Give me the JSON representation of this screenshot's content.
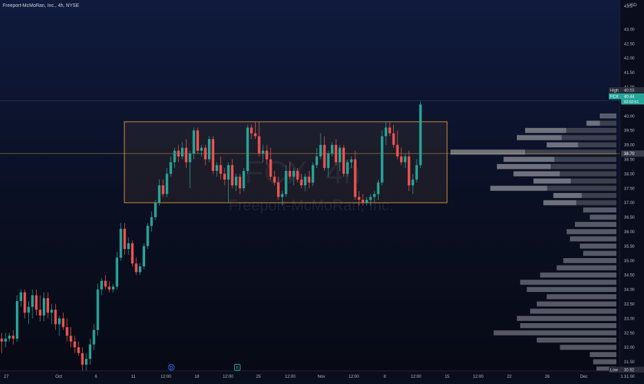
{
  "header": {
    "symbol_title": "Freeport-McMoRan, Inc., 4h, NYSE",
    "currency": "USD"
  },
  "watermark": {
    "ticker": "FCX, 4h",
    "name": "Freeport-McMoRan, Inc."
  },
  "colors": {
    "up": "#26a69a",
    "down": "#ef5350",
    "range_box": "#e8a33d",
    "volume_profile": "#787b86",
    "volume_profile_value_area": "#434651",
    "last_price_bg": "#26a69a",
    "high_bg": "#2a2e39",
    "low_bg": "#2a2e39"
  },
  "price_labels": {
    "high_label": "High",
    "high_value": "40.53",
    "ticker_label": "FCX",
    "last_value": "40.44",
    "countdown": "02:02:51",
    "level_value": "38.70",
    "low_label": "Low",
    "low_value": "30.92"
  },
  "event_markers": [
    {
      "label": "D",
      "x_label": "11"
    },
    {
      "label": "E",
      "x_label": "18"
    }
  ],
  "chart_data": {
    "type": "candlestick",
    "title": "Freeport-McMoRan, Inc., 4h, NYSE",
    "xlabel": "",
    "ylabel": "",
    "ylim": [
      30.9,
      43.6
    ],
    "y_ticks": [
      "43.00",
      "42.50",
      "42.00",
      "41.50",
      "41.00",
      "40.50",
      "40.00",
      "39.50",
      "39.00",
      "38.50",
      "38.00",
      "37.50",
      "37.00",
      "36.50",
      "36.00",
      "35.50",
      "35.00",
      "34.50",
      "34.00",
      "33.50",
      "33.00",
      "32.50",
      "32.00",
      "31.50",
      "31.00"
    ],
    "top_tick_partial": "43.5",
    "x_ticks": [
      "27",
      "Oct",
      "6",
      "11",
      "12:00",
      "18",
      "12:00",
      "25",
      "12:00",
      "Nov",
      "12:00",
      "8",
      "12:00",
      "15",
      "12:00",
      "22",
      "26",
      "Dec",
      "1"
    ],
    "grid": false,
    "horizontal_level": 38.7,
    "range_box": {
      "price_top": 39.8,
      "price_bottom": 37.0
    },
    "candles": [
      {
        "o": 32.3,
        "h": 32.5,
        "l": 31.8,
        "c": 32.2
      },
      {
        "o": 32.2,
        "h": 32.5,
        "l": 32.0,
        "c": 32.3
      },
      {
        "o": 32.3,
        "h": 32.5,
        "l": 32.2,
        "c": 32.4
      },
      {
        "o": 32.4,
        "h": 32.6,
        "l": 32.1,
        "c": 32.3
      },
      {
        "o": 32.3,
        "h": 33.8,
        "l": 32.2,
        "c": 33.6
      },
      {
        "o": 33.6,
        "h": 34.0,
        "l": 33.4,
        "c": 33.9
      },
      {
        "o": 33.9,
        "h": 34.0,
        "l": 33.0,
        "c": 33.2
      },
      {
        "o": 33.2,
        "h": 33.6,
        "l": 32.8,
        "c": 33.4
      },
      {
        "o": 33.4,
        "h": 34.0,
        "l": 33.0,
        "c": 33.8
      },
      {
        "o": 33.8,
        "h": 34.0,
        "l": 33.1,
        "c": 33.3
      },
      {
        "o": 33.3,
        "h": 33.8,
        "l": 32.9,
        "c": 33.1
      },
      {
        "o": 33.1,
        "h": 33.9,
        "l": 32.9,
        "c": 33.7
      },
      {
        "o": 33.7,
        "h": 33.9,
        "l": 33.0,
        "c": 33.2
      },
      {
        "o": 33.2,
        "h": 33.5,
        "l": 32.8,
        "c": 33.3
      },
      {
        "o": 33.3,
        "h": 33.5,
        "l": 32.6,
        "c": 32.8
      },
      {
        "o": 32.8,
        "h": 33.1,
        "l": 32.4,
        "c": 33.0
      },
      {
        "o": 33.0,
        "h": 33.2,
        "l": 32.6,
        "c": 32.7
      },
      {
        "o": 32.7,
        "h": 33.0,
        "l": 32.2,
        "c": 32.4
      },
      {
        "o": 32.4,
        "h": 32.7,
        "l": 32.0,
        "c": 32.2
      },
      {
        "o": 32.2,
        "h": 32.4,
        "l": 31.8,
        "c": 32.0
      },
      {
        "o": 32.0,
        "h": 32.2,
        "l": 31.7,
        "c": 31.8
      },
      {
        "o": 31.8,
        "h": 32.0,
        "l": 31.2,
        "c": 31.4
      },
      {
        "o": 31.4,
        "h": 31.8,
        "l": 31.0,
        "c": 31.6
      },
      {
        "o": 31.6,
        "h": 32.3,
        "l": 31.4,
        "c": 32.1
      },
      {
        "o": 32.1,
        "h": 32.8,
        "l": 31.9,
        "c": 32.6
      },
      {
        "o": 32.6,
        "h": 34.2,
        "l": 32.4,
        "c": 34.0
      },
      {
        "o": 34.0,
        "h": 34.4,
        "l": 33.8,
        "c": 34.3
      },
      {
        "o": 34.3,
        "h": 34.5,
        "l": 34.0,
        "c": 34.1
      },
      {
        "o": 34.1,
        "h": 34.3,
        "l": 33.9,
        "c": 34.0
      },
      {
        "o": 34.0,
        "h": 34.2,
        "l": 33.9,
        "c": 34.1
      },
      {
        "o": 34.1,
        "h": 35.3,
        "l": 34.0,
        "c": 35.1
      },
      {
        "o": 35.1,
        "h": 36.3,
        "l": 35.0,
        "c": 36.1
      },
      {
        "o": 36.1,
        "h": 36.3,
        "l": 35.2,
        "c": 35.4
      },
      {
        "o": 35.4,
        "h": 35.8,
        "l": 35.2,
        "c": 35.6
      },
      {
        "o": 35.6,
        "h": 35.7,
        "l": 34.8,
        "c": 34.9
      },
      {
        "o": 34.9,
        "h": 35.1,
        "l": 34.5,
        "c": 34.6
      },
      {
        "o": 34.6,
        "h": 34.9,
        "l": 34.5,
        "c": 34.8
      },
      {
        "o": 34.8,
        "h": 35.6,
        "l": 34.7,
        "c": 35.5
      },
      {
        "o": 35.5,
        "h": 36.3,
        "l": 35.4,
        "c": 36.2
      },
      {
        "o": 36.2,
        "h": 36.7,
        "l": 36.0,
        "c": 36.5
      },
      {
        "o": 36.5,
        "h": 37.1,
        "l": 36.4,
        "c": 37.0
      },
      {
        "o": 37.0,
        "h": 37.8,
        "l": 36.9,
        "c": 37.6
      },
      {
        "o": 37.6,
        "h": 37.8,
        "l": 37.2,
        "c": 37.3
      },
      {
        "o": 37.3,
        "h": 38.2,
        "l": 37.2,
        "c": 38.0
      },
      {
        "o": 38.0,
        "h": 38.6,
        "l": 37.9,
        "c": 38.4
      },
      {
        "o": 38.4,
        "h": 38.9,
        "l": 38.2,
        "c": 38.8
      },
      {
        "o": 38.8,
        "h": 39.0,
        "l": 38.4,
        "c": 38.6
      },
      {
        "o": 38.6,
        "h": 39.1,
        "l": 38.5,
        "c": 38.9
      },
      {
        "o": 38.9,
        "h": 39.2,
        "l": 38.2,
        "c": 38.4
      },
      {
        "o": 38.4,
        "h": 38.8,
        "l": 37.5,
        "c": 38.7
      },
      {
        "o": 38.7,
        "h": 39.6,
        "l": 38.5,
        "c": 39.5
      },
      {
        "o": 39.5,
        "h": 39.6,
        "l": 38.7,
        "c": 38.8
      },
      {
        "o": 38.8,
        "h": 39.0,
        "l": 38.6,
        "c": 38.9
      },
      {
        "o": 38.9,
        "h": 39.0,
        "l": 38.3,
        "c": 38.5
      },
      {
        "o": 38.5,
        "h": 39.3,
        "l": 38.4,
        "c": 39.2
      },
      {
        "o": 39.2,
        "h": 39.3,
        "l": 38.0,
        "c": 38.1
      },
      {
        "o": 38.1,
        "h": 38.4,
        "l": 37.9,
        "c": 38.3
      },
      {
        "o": 38.3,
        "h": 38.6,
        "l": 37.8,
        "c": 38.0
      },
      {
        "o": 38.0,
        "h": 38.2,
        "l": 37.6,
        "c": 37.8
      },
      {
        "o": 37.8,
        "h": 38.4,
        "l": 37.0,
        "c": 38.3
      },
      {
        "o": 38.3,
        "h": 38.5,
        "l": 37.5,
        "c": 37.6
      },
      {
        "o": 37.6,
        "h": 38.0,
        "l": 37.4,
        "c": 37.9
      },
      {
        "o": 37.9,
        "h": 38.0,
        "l": 37.3,
        "c": 37.5
      },
      {
        "o": 37.5,
        "h": 38.2,
        "l": 37.4,
        "c": 38.1
      },
      {
        "o": 38.1,
        "h": 39.7,
        "l": 38.0,
        "c": 39.6
      },
      {
        "o": 39.6,
        "h": 39.7,
        "l": 39.2,
        "c": 39.4
      },
      {
        "o": 39.4,
        "h": 39.8,
        "l": 39.2,
        "c": 39.3
      },
      {
        "o": 39.3,
        "h": 39.8,
        "l": 38.6,
        "c": 38.7
      },
      {
        "o": 38.7,
        "h": 39.0,
        "l": 38.4,
        "c": 38.8
      },
      {
        "o": 38.8,
        "h": 39.0,
        "l": 38.3,
        "c": 38.5
      },
      {
        "o": 38.5,
        "h": 38.9,
        "l": 37.8,
        "c": 37.9
      },
      {
        "o": 37.9,
        "h": 38.1,
        "l": 37.6,
        "c": 37.7
      },
      {
        "o": 37.7,
        "h": 37.9,
        "l": 37.1,
        "c": 37.2
      },
      {
        "o": 37.2,
        "h": 37.4,
        "l": 36.9,
        "c": 37.3
      },
      {
        "o": 37.3,
        "h": 38.3,
        "l": 37.2,
        "c": 38.1
      },
      {
        "o": 38.1,
        "h": 38.4,
        "l": 37.8,
        "c": 37.9
      },
      {
        "o": 37.9,
        "h": 38.2,
        "l": 37.6,
        "c": 38.1
      },
      {
        "o": 38.1,
        "h": 38.2,
        "l": 37.7,
        "c": 37.8
      },
      {
        "o": 37.8,
        "h": 38.0,
        "l": 37.5,
        "c": 37.6
      },
      {
        "o": 37.6,
        "h": 38.0,
        "l": 37.4,
        "c": 37.9
      },
      {
        "o": 37.9,
        "h": 38.1,
        "l": 37.5,
        "c": 37.7
      },
      {
        "o": 37.7,
        "h": 38.4,
        "l": 37.6,
        "c": 38.3
      },
      {
        "o": 38.3,
        "h": 38.9,
        "l": 38.2,
        "c": 38.6
      },
      {
        "o": 38.6,
        "h": 39.4,
        "l": 38.5,
        "c": 39.0
      },
      {
        "o": 39.0,
        "h": 39.3,
        "l": 38.1,
        "c": 38.2
      },
      {
        "o": 38.2,
        "h": 38.8,
        "l": 37.9,
        "c": 38.7
      },
      {
        "o": 38.7,
        "h": 39.1,
        "l": 38.6,
        "c": 39.0
      },
      {
        "o": 39.0,
        "h": 39.2,
        "l": 38.3,
        "c": 38.4
      },
      {
        "o": 38.4,
        "h": 39.0,
        "l": 38.1,
        "c": 38.9
      },
      {
        "o": 38.9,
        "h": 39.0,
        "l": 37.9,
        "c": 38.0
      },
      {
        "o": 38.0,
        "h": 38.5,
        "l": 37.9,
        "c": 38.4
      },
      {
        "o": 38.4,
        "h": 38.6,
        "l": 38.2,
        "c": 38.5
      },
      {
        "o": 38.5,
        "h": 38.8,
        "l": 37.1,
        "c": 37.2
      },
      {
        "o": 37.2,
        "h": 37.4,
        "l": 36.9,
        "c": 37.1
      },
      {
        "o": 37.1,
        "h": 37.3,
        "l": 36.9,
        "c": 37.0
      },
      {
        "o": 37.0,
        "h": 37.2,
        "l": 36.9,
        "c": 37.1
      },
      {
        "o": 37.1,
        "h": 37.3,
        "l": 36.9,
        "c": 37.2
      },
      {
        "o": 37.2,
        "h": 37.4,
        "l": 37.0,
        "c": 37.3
      },
      {
        "o": 37.3,
        "h": 37.8,
        "l": 37.1,
        "c": 37.7
      },
      {
        "o": 37.7,
        "h": 39.5,
        "l": 37.6,
        "c": 39.3
      },
      {
        "o": 39.3,
        "h": 39.8,
        "l": 39.0,
        "c": 39.6
      },
      {
        "o": 39.6,
        "h": 39.8,
        "l": 39.3,
        "c": 39.4
      },
      {
        "o": 39.4,
        "h": 39.7,
        "l": 38.9,
        "c": 39.0
      },
      {
        "o": 39.0,
        "h": 39.5,
        "l": 38.5,
        "c": 38.6
      },
      {
        "o": 38.6,
        "h": 38.9,
        "l": 38.3,
        "c": 38.4
      },
      {
        "o": 38.4,
        "h": 38.7,
        "l": 38.2,
        "c": 38.6
      },
      {
        "o": 38.6,
        "h": 38.8,
        "l": 37.4,
        "c": 37.6
      },
      {
        "o": 37.6,
        "h": 38.0,
        "l": 37.3,
        "c": 37.8
      },
      {
        "o": 37.8,
        "h": 38.5,
        "l": 37.7,
        "c": 38.3
      },
      {
        "o": 38.3,
        "h": 40.5,
        "l": 38.2,
        "c": 40.4
      }
    ],
    "volume_profile": [
      {
        "price": 40.0,
        "volume": 10
      },
      {
        "price": 39.75,
        "volume": 18
      },
      {
        "price": 39.5,
        "volume": 55
      },
      {
        "price": 39.25,
        "volume": 60
      },
      {
        "price": 39.0,
        "volume": 42
      },
      {
        "price": 38.75,
        "volume": 100
      },
      {
        "price": 38.5,
        "volume": 68
      },
      {
        "price": 38.25,
        "volume": 72
      },
      {
        "price": 38.0,
        "volume": 62
      },
      {
        "price": 37.75,
        "volume": 50
      },
      {
        "price": 37.5,
        "volume": 76
      },
      {
        "price": 37.25,
        "volume": 38
      },
      {
        "price": 37.0,
        "volume": 44
      },
      {
        "price": 36.75,
        "volume": 20
      },
      {
        "price": 36.5,
        "volume": 16
      },
      {
        "price": 36.25,
        "volume": 25
      },
      {
        "price": 36.0,
        "volume": 30
      },
      {
        "price": 35.75,
        "volume": 28
      },
      {
        "price": 35.5,
        "volume": 22
      },
      {
        "price": 35.25,
        "volume": 20
      },
      {
        "price": 35.0,
        "volume": 32
      },
      {
        "price": 34.75,
        "volume": 36
      },
      {
        "price": 34.5,
        "volume": 46
      },
      {
        "price": 34.25,
        "volume": 58
      },
      {
        "price": 34.0,
        "volume": 54
      },
      {
        "price": 33.75,
        "volume": 42
      },
      {
        "price": 33.5,
        "volume": 48
      },
      {
        "price": 33.25,
        "volume": 52
      },
      {
        "price": 33.0,
        "volume": 60
      },
      {
        "price": 32.75,
        "volume": 58
      },
      {
        "price": 32.5,
        "volume": 74
      },
      {
        "price": 32.25,
        "volume": 48
      },
      {
        "price": 32.0,
        "volume": 34
      },
      {
        "price": 31.75,
        "volume": 16
      },
      {
        "price": 31.5,
        "volume": 14
      },
      {
        "price": 31.25,
        "volume": 12
      },
      {
        "price": 31.0,
        "volume": 10
      }
    ]
  }
}
